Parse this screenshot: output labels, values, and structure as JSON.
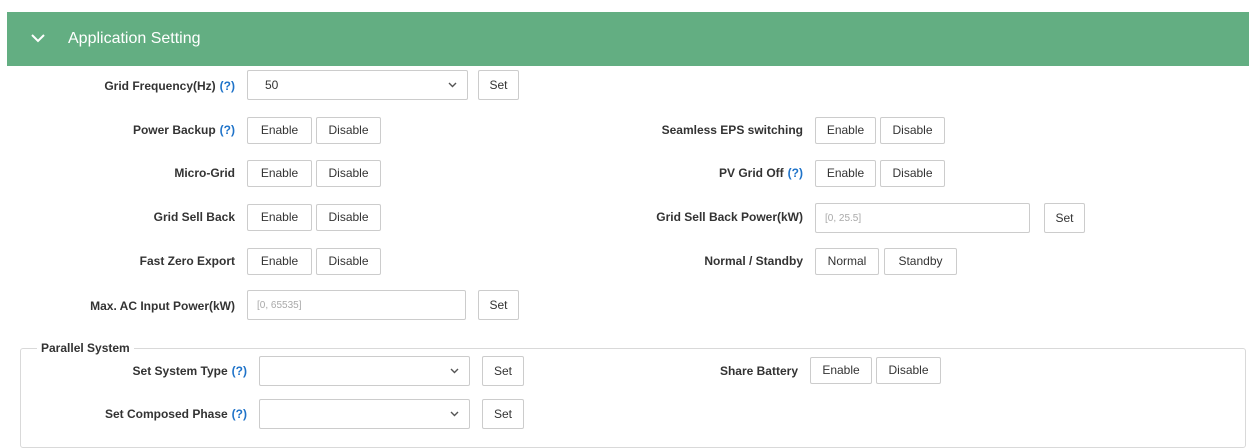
{
  "header": {
    "title": "Application Setting",
    "icon": "chevron-down-icon"
  },
  "help_mark": "(?)",
  "colors": {
    "header_bg": "#63ae82",
    "help_link": "#1f73c9"
  },
  "grid_frequency": {
    "label": "Grid Frequency(Hz)",
    "value": "50",
    "set_label": "Set"
  },
  "power_backup": {
    "label": "Power Backup",
    "enable": "Enable",
    "disable": "Disable"
  },
  "micro_grid": {
    "label": "Micro-Grid",
    "enable": "Enable",
    "disable": "Disable"
  },
  "grid_sell_back": {
    "label": "Grid Sell Back",
    "enable": "Enable",
    "disable": "Disable"
  },
  "fast_zero_export": {
    "label": "Fast Zero Export",
    "enable": "Enable",
    "disable": "Disable"
  },
  "max_ac_input": {
    "label": "Max. AC Input Power(kW)",
    "placeholder": "[0, 65535]",
    "set_label": "Set"
  },
  "seamless_eps": {
    "label": "Seamless EPS switching",
    "enable": "Enable",
    "disable": "Disable"
  },
  "pv_grid_off": {
    "label": "PV Grid Off",
    "enable": "Enable",
    "disable": "Disable"
  },
  "grid_sell_back_power": {
    "label": "Grid Sell Back Power(kW)",
    "placeholder": "[0, 25.5]",
    "set_label": "Set"
  },
  "normal_standby": {
    "label": "Normal / Standby",
    "normal": "Normal",
    "standby": "Standby"
  },
  "parallel": {
    "legend": "Parallel System",
    "system_type": {
      "label": "Set System Type",
      "value": "",
      "set_label": "Set"
    },
    "composed_phase": {
      "label": "Set Composed Phase",
      "value": "",
      "set_label": "Set"
    },
    "share_battery": {
      "label": "Share Battery",
      "enable": "Enable",
      "disable": "Disable"
    }
  }
}
